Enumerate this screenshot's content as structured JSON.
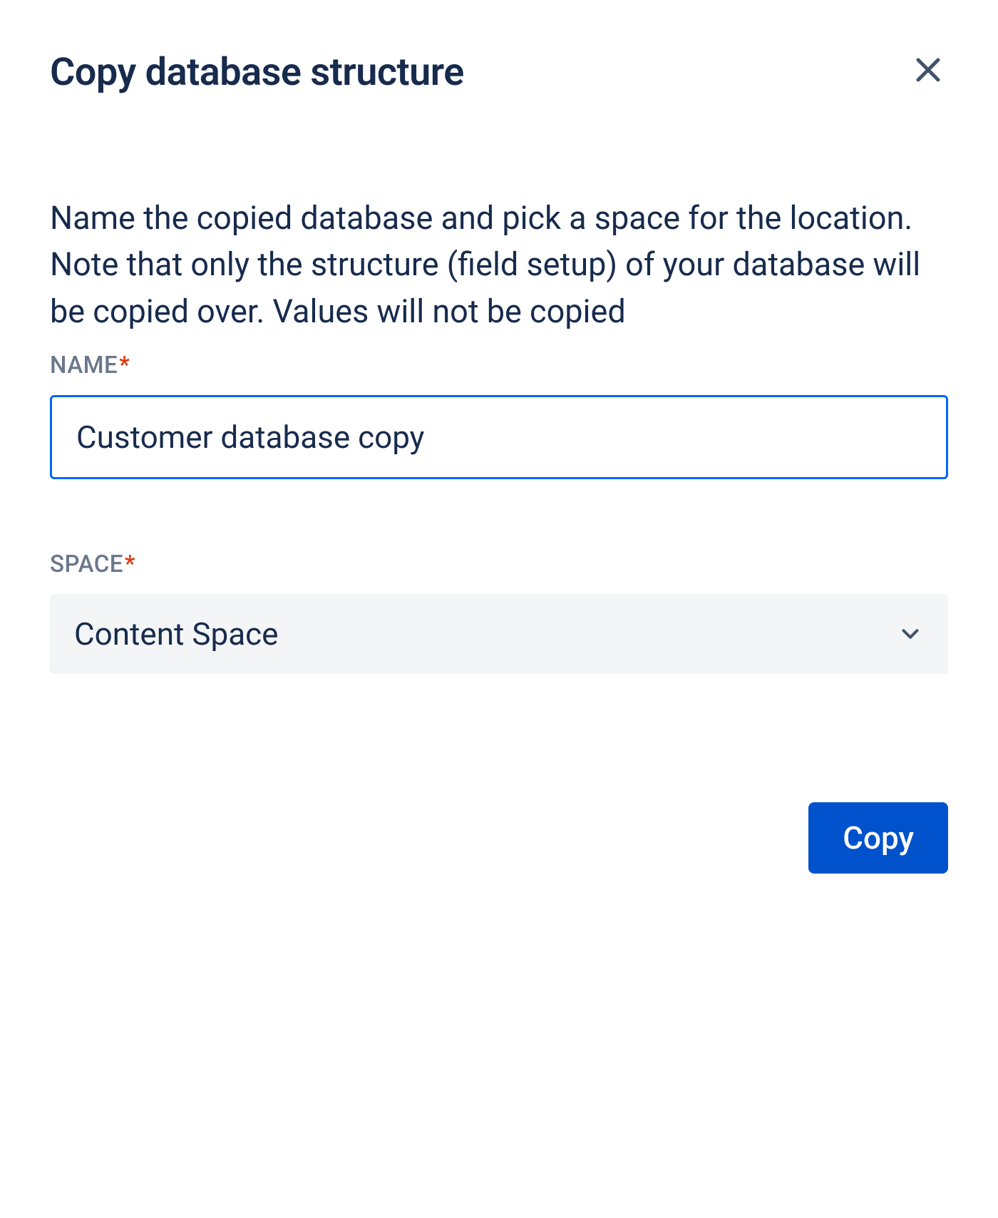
{
  "dialog": {
    "title": "Copy database structure",
    "description": "Name the copied database and pick a space for the location. Note that only the structure (field setup) of your database will be copied over. Values will not be copied",
    "fields": {
      "name": {
        "label": "NAME",
        "value": "Customer database copy",
        "required": true
      },
      "space": {
        "label": "SPACE",
        "selected": "Content Space",
        "required": true
      }
    },
    "actions": {
      "copy_label": "Copy"
    }
  }
}
